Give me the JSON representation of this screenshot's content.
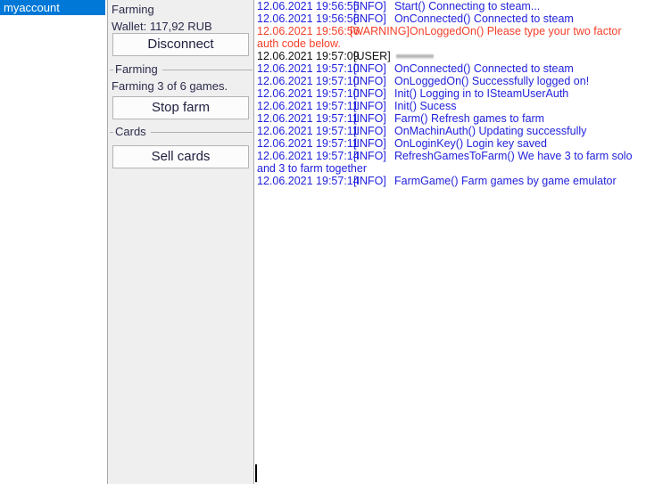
{
  "accounts": {
    "items": [
      {
        "label": "myaccount",
        "selected": true
      }
    ]
  },
  "control_panel": {
    "header": "Farming",
    "wallet": "Wallet: 117,92 RUB",
    "disconnect_button": "Disconnect",
    "farming_group": {
      "caption": "Farming",
      "status": "Farming 3 of 6 games.",
      "stop_button": "Stop farm"
    },
    "cards_group": {
      "caption": "Cards",
      "sell_button": "Sell cards"
    }
  },
  "log": {
    "lines": [
      {
        "time": "12.06.2021 19:56:55",
        "level": "[INFO]",
        "level_class": "info",
        "message": "Start() Connecting to steam..."
      },
      {
        "time": "12.06.2021 19:56:56",
        "level": "[INFO]",
        "level_class": "info",
        "message": "OnConnected() Connected to steam"
      },
      {
        "time": "12.06.2021 19:56:56",
        "level": "[WARNING]",
        "level_class": "warning",
        "message": "OnLoggedOn() Please type your two factor auth code below."
      },
      {
        "time": "12.06.2021 19:57:09",
        "level": "[USER]",
        "level_class": "user",
        "message": "",
        "redacted": true
      },
      {
        "time": "12.06.2021 19:57:10",
        "level": "[INFO]",
        "level_class": "info",
        "message": "OnConnected() Connected to steam"
      },
      {
        "time": "12.06.2021 19:57:10",
        "level": "[INFO]",
        "level_class": "info",
        "message": "OnLoggedOn() Successfully logged on!"
      },
      {
        "time": "12.06.2021 19:57:10",
        "level": "[INFO]",
        "level_class": "info",
        "message": "Init() Logging in to ISteamUserAuth"
      },
      {
        "time": "12.06.2021 19:57:11",
        "level": "[INFO]",
        "level_class": "info",
        "message": "Init() Sucess"
      },
      {
        "time": "12.06.2021 19:57:11",
        "level": "[INFO]",
        "level_class": "info",
        "message": "Farm() Refresh games to farm"
      },
      {
        "time": "12.06.2021 19:57:11",
        "level": "[INFO]",
        "level_class": "info",
        "message": "OnMachinAuth() Updating successfully"
      },
      {
        "time": "12.06.2021 19:57:11",
        "level": "[INFO]",
        "level_class": "info",
        "message": "OnLoginKey() Login key saved"
      },
      {
        "time": "12.06.2021 19:57:14",
        "level": "[INFO]",
        "level_class": "info",
        "message": "RefreshGamesToFarm() We have 3 to farm solo and 3 to farm together"
      },
      {
        "time": "12.06.2021 19:57:14",
        "level": "[INFO]",
        "level_class": "info",
        "message": "FarmGame() Farm games by game emulator"
      }
    ]
  },
  "colors": {
    "selection_blue": "#0078d7",
    "info_blue": "#2222dd",
    "warning_red": "#f4402a",
    "user_black": "#101010",
    "panel_background": "#efeff0"
  }
}
